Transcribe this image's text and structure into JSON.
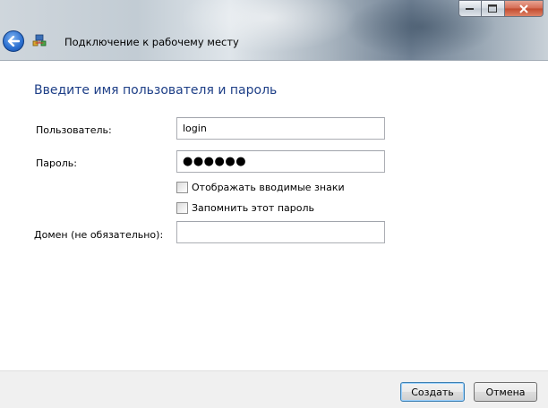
{
  "window": {
    "title": "Подключение к рабочему месту",
    "controls": {
      "minimize_icon": "minimize-icon",
      "maximize_icon": "maximize-icon",
      "close_icon": "close-icon"
    },
    "back_icon": "back-arrow-icon",
    "app_icon": "network-connection-icon"
  },
  "form": {
    "heading": "Введите имя пользователя и пароль",
    "user_label": "Пользователь:",
    "user_value": "login",
    "password_label": "Пароль:",
    "password_value": "●●●●●●",
    "show_chars_label": "Отображать вводимые знаки",
    "show_chars_checked": false,
    "remember_label": "Запомнить этот пароль",
    "remember_checked": false,
    "domain_label": "Домен (не обязательно):",
    "domain_value": ""
  },
  "buttons": {
    "create": "Создать",
    "cancel": "Отмена"
  },
  "colors": {
    "heading": "#1e3f87",
    "footer_bg": "#f0f0f0",
    "close_button": "#c24a2e"
  }
}
